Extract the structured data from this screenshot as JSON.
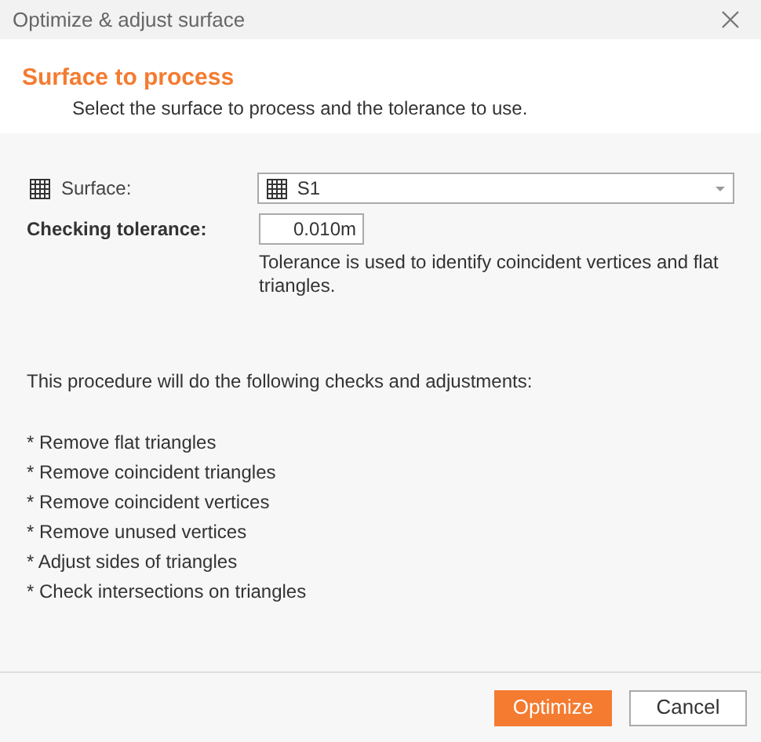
{
  "window": {
    "title": "Optimize & adjust surface"
  },
  "header": {
    "title": "Surface to process",
    "subtitle": "Select the surface to process and the tolerance to use."
  },
  "surface": {
    "label": "Surface:",
    "value": "S1"
  },
  "tolerance": {
    "label": "Checking tolerance:",
    "value": "0.010m",
    "help": "Tolerance is used to identify coincident vertices and flat triangles."
  },
  "procedure": {
    "intro": "This procedure will do the following checks and adjustments:",
    "items": [
      "* Remove flat triangles",
      "* Remove coincident triangles",
      "* Remove coincident vertices",
      "* Remove unused vertices",
      "* Adjust sides of triangles",
      "* Check intersections on triangles"
    ]
  },
  "buttons": [
    {
      "label": "Optimize",
      "kind": "primary"
    },
    {
      "label": "Cancel",
      "kind": "secondary"
    }
  ]
}
